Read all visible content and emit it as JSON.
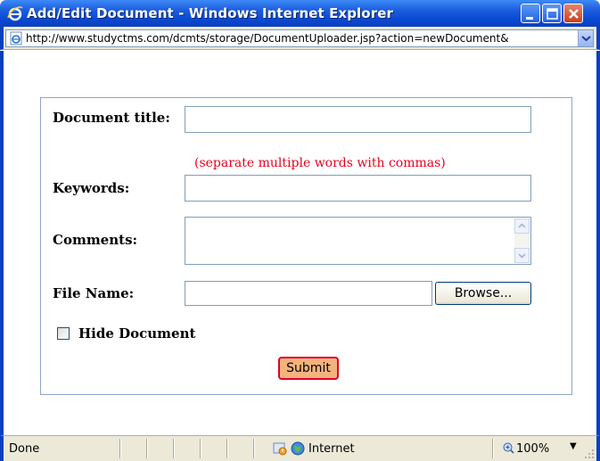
{
  "window": {
    "title": "Add/Edit Document - Windows Internet Explorer",
    "icon": "ie-icon"
  },
  "address_bar": {
    "url": "http://www.studyctms.com/dcmts/storage/DocumentUploader.jsp?action=newDocument&"
  },
  "form": {
    "document_title_label": "Document title:",
    "document_title_value": "",
    "keywords_hint": "(separate multiple words with commas)",
    "keywords_label": "Keywords:",
    "keywords_value": "",
    "comments_label": "Comments:",
    "comments_value": "",
    "file_name_label": "File Name:",
    "file_name_value": "",
    "browse_label": "Browse...",
    "hide_document_label": "Hide Document",
    "hide_document_checked": false,
    "submit_label": "Submit"
  },
  "status_bar": {
    "status": "Done",
    "zone": "Internet",
    "zoom": "100%"
  },
  "colors": {
    "titlebar": "#0a4ad4",
    "hint_text": "#e8001c",
    "submit_bg": "#f3b37c",
    "submit_border": "#e0002c",
    "panel_border": "#8ea5c8"
  }
}
